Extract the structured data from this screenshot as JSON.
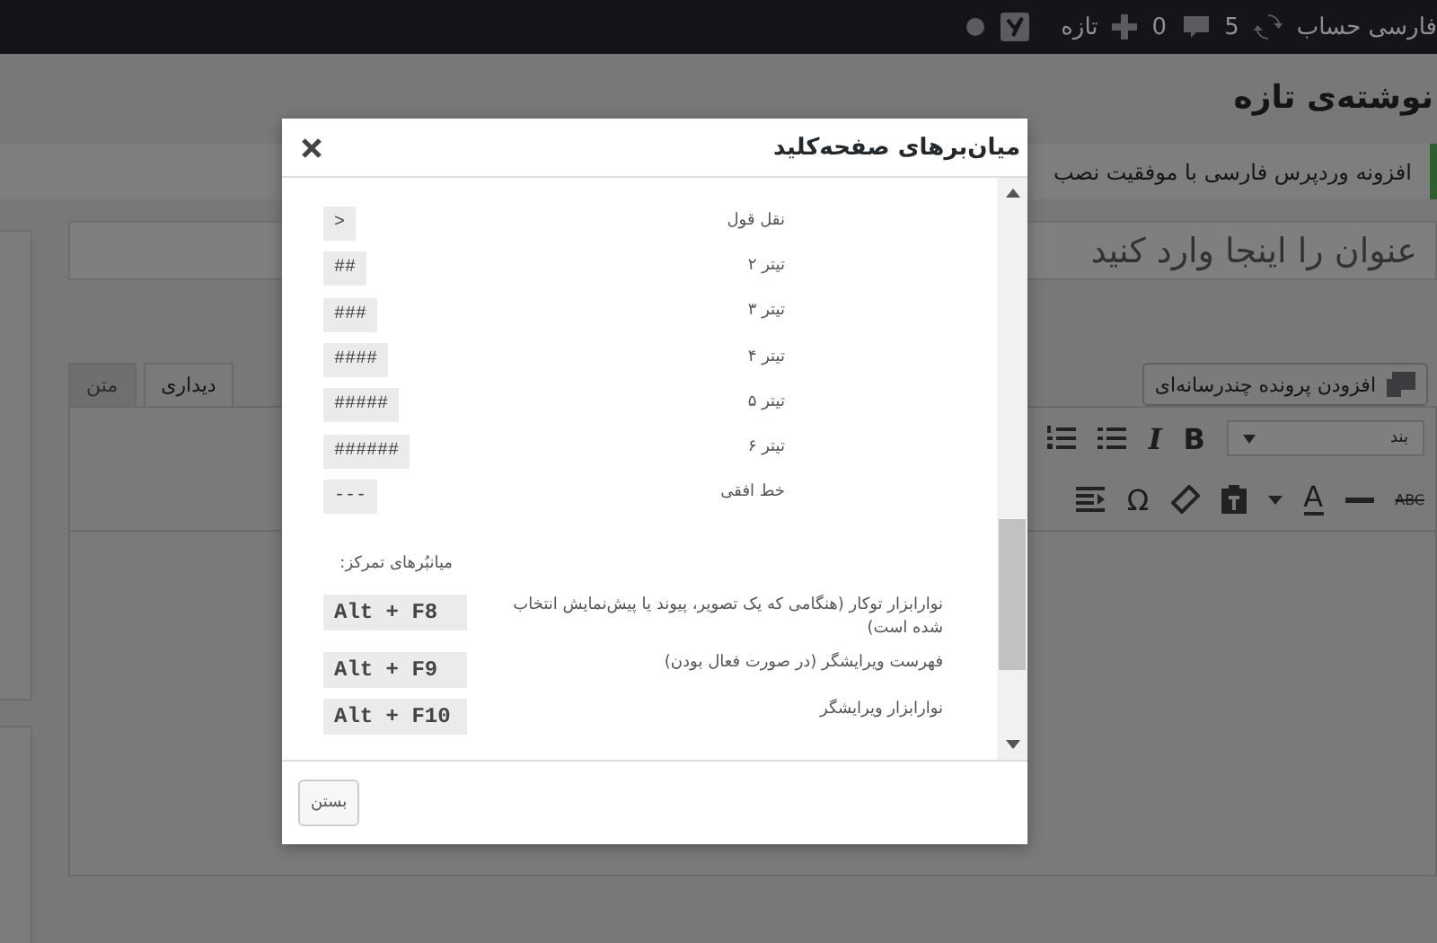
{
  "admin_bar": {
    "account": "فارسی حساب",
    "updates": "5",
    "comments": "0",
    "new_label": "تازه"
  },
  "page_title": "نوشته‌ی تازه",
  "notice": "افزونه وردپرس فارسی با موفقیت نصب",
  "title_field": {
    "placeholder": "عنوان را اینجا وارد کنید"
  },
  "add_media": "افزودن پرونده چندرسانه‌ای",
  "editor_tabs": [
    {
      "label": "دیداری",
      "selected": true
    },
    {
      "label": "متن",
      "selected": false
    }
  ],
  "format_select": "بند",
  "toolbar_row_1": [
    "B",
    "I"
  ],
  "toolbar_row_2": [
    "ABC",
    "A",
    "Ω"
  ],
  "dialog": {
    "title": "میان‌برهای صفحه‌کلید",
    "formatting": [
      {
        "code": ">",
        "label": "نقل قول"
      },
      {
        "code": "##",
        "label": "تیتر ۲"
      },
      {
        "code": "###",
        "label": "تیتر ۳"
      },
      {
        "code": "####",
        "label": "تیتر ۴"
      },
      {
        "code": "#####",
        "label": "تیتر ۵"
      },
      {
        "code": "######",
        "label": "تیتر ۶"
      },
      {
        "code": "---",
        "label": "خط افقی"
      }
    ],
    "focus_heading": "میانبُرهای تمرکز:",
    "focus": [
      {
        "code": "Alt + F8",
        "label": "نوارابزار توکار (هنگامی که یک تصویر، پیوند یا پیش‌نمایش انتخاب شده است)"
      },
      {
        "code": "Alt + F9",
        "label": "فهرست ویرایشگر (در صورت فعال بودن)"
      },
      {
        "code": "Alt + F10",
        "label": "نوارابزار ویرایشگر"
      }
    ],
    "close_button": "بستن"
  }
}
